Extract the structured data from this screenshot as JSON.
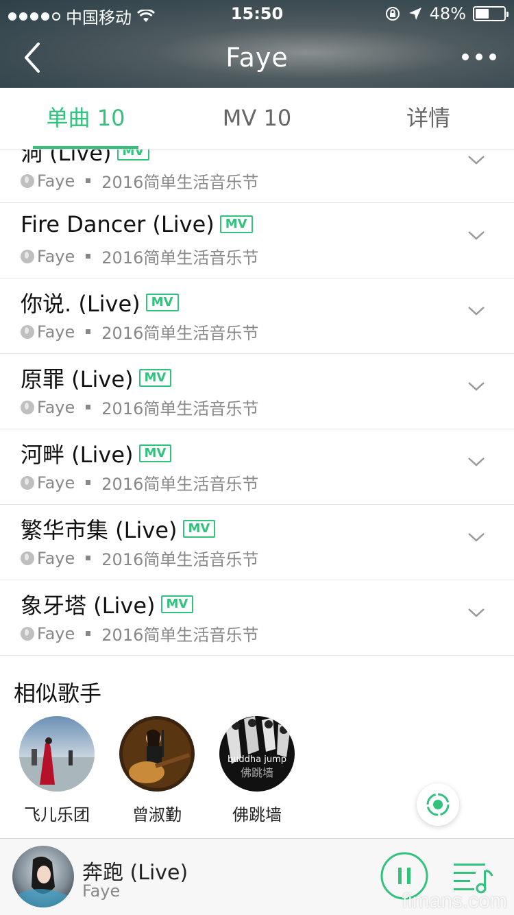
{
  "status_bar": {
    "carrier": "中国移动",
    "time": "15:50",
    "battery": "48%",
    "battery_level": 0.48
  },
  "nav": {
    "title": "Faye"
  },
  "tabs": [
    {
      "label": "单曲 10",
      "active": true
    },
    {
      "label": "MV 10",
      "active": false
    },
    {
      "label": "详情",
      "active": false
    }
  ],
  "songs": [
    {
      "title": "洞 (Live)",
      "badge": "MV",
      "artist": "Faye",
      "album": "2016简单生活音乐节"
    },
    {
      "title": "Fire Dancer (Live)",
      "badge": "MV",
      "artist": "Faye",
      "album": "2016简单生活音乐节"
    },
    {
      "title": "你说. (Live)",
      "badge": "MV",
      "artist": "Faye",
      "album": "2016简单生活音乐节"
    },
    {
      "title": "原罪 (Live)",
      "badge": "MV",
      "artist": "Faye",
      "album": "2016简单生活音乐节"
    },
    {
      "title": "河畔 (Live)",
      "badge": "MV",
      "artist": "Faye",
      "album": "2016简单生活音乐节"
    },
    {
      "title": "繁华市集 (Live)",
      "badge": "MV",
      "artist": "Faye",
      "album": "2016简单生活音乐节"
    },
    {
      "title": "象牙塔 (Live)",
      "badge": "MV",
      "artist": "Faye",
      "album": "2016简单生活音乐节"
    }
  ],
  "similar": {
    "title": "相似歌手",
    "artists": [
      {
        "name": "飞儿乐团"
      },
      {
        "name": "曾淑勤"
      },
      {
        "name": "佛跳墙",
        "cover_text": "buddha jump"
      }
    ]
  },
  "player": {
    "title": "奔跑 (Live)",
    "artist": "Faye"
  },
  "watermark": "fimans.com",
  "colors": {
    "accent": "#31c27c"
  }
}
